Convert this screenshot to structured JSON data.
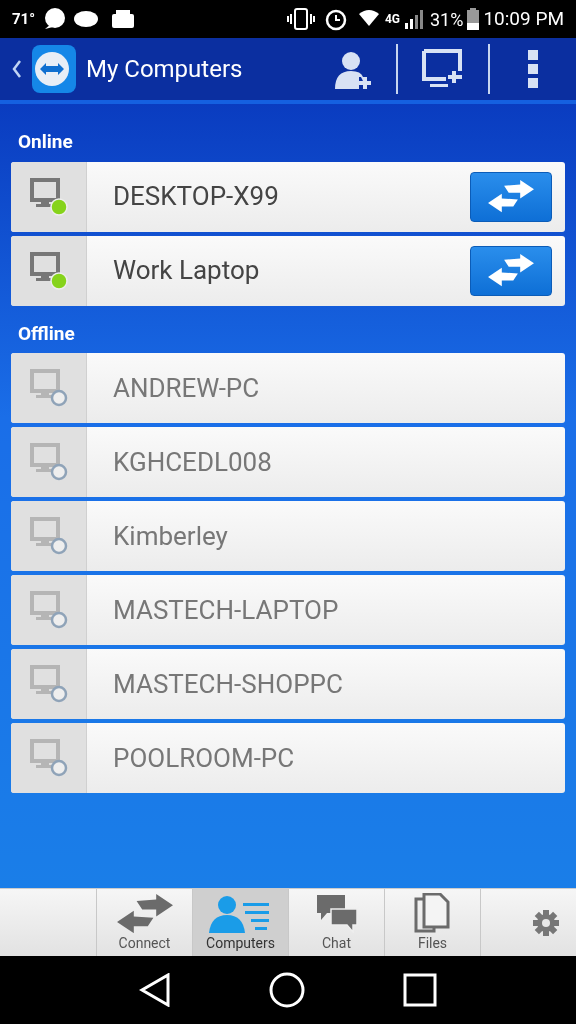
{
  "status_bar": {
    "temperature": "71°",
    "network": "4G",
    "battery": "31%",
    "time": "10:09 PM"
  },
  "app_bar": {
    "title": "My Computers"
  },
  "sections": [
    {
      "title": "Online",
      "computers": [
        {
          "name": "DESKTOP-X99",
          "online": true
        },
        {
          "name": "Work Laptop",
          "online": true
        }
      ]
    },
    {
      "title": "Offline",
      "computers": [
        {
          "name": "ANDREW-PC",
          "online": false
        },
        {
          "name": "KGHCEDL008",
          "online": false
        },
        {
          "name": "Kimberley",
          "online": false
        },
        {
          "name": "MASTECH-LAPTOP",
          "online": false
        },
        {
          "name": "MASTECH-SHOPPC",
          "online": false
        },
        {
          "name": "POOLROOM-PC",
          "online": false
        }
      ]
    }
  ],
  "tabs": [
    {
      "label": "Connect",
      "kind": "connect",
      "selected": false
    },
    {
      "label": "Computers",
      "kind": "computers",
      "selected": true
    },
    {
      "label": "Chat",
      "kind": "chat",
      "selected": false
    },
    {
      "label": "Files",
      "kind": "files",
      "selected": false
    }
  ]
}
